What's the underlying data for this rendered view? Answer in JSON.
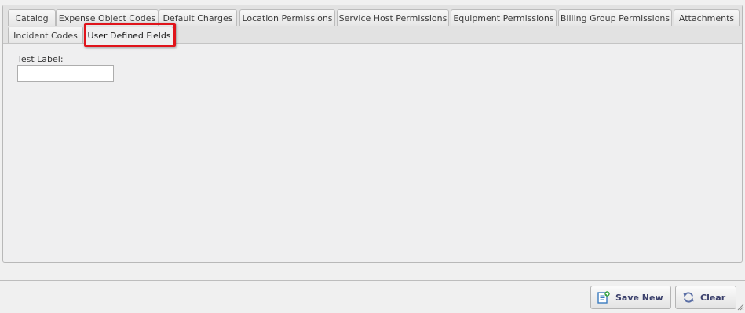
{
  "tabs": [
    {
      "label": "Catalog"
    },
    {
      "label": "Expense Object Codes"
    },
    {
      "label": "Default Charges"
    },
    {
      "label": "Location Permissions"
    },
    {
      "label": "Service Host Permissions"
    },
    {
      "label": "Equipment Permissions"
    },
    {
      "label": "Billing Group Permissions"
    },
    {
      "label": "Attachments"
    },
    {
      "label": "Incident Codes"
    },
    {
      "label": "User Defined Fields"
    }
  ],
  "active_tab": "User Defined Fields",
  "form": {
    "test_label": "Test Label:",
    "test_value": ""
  },
  "actions": {
    "save_new": "Save New",
    "clear": "Clear"
  },
  "colors": {
    "highlight": "#e0141b",
    "button_text": "#3a3f6b",
    "save_icon": "#3a7bbf",
    "clear_icon": "#5b6fa5"
  },
  "icons": {
    "save_new": "document-add-icon",
    "clear": "refresh-icon"
  }
}
